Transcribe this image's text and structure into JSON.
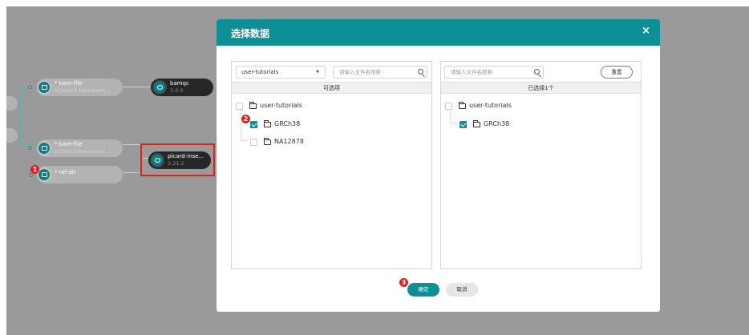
{
  "canvas": {
    "nodes": [
      {
        "title": "* bam-file",
        "subtitle": "${task-2-bwa-mem..."
      },
      {
        "title": "bamqc",
        "subtitle": "2.0.0"
      },
      {
        "title": "* bam-file",
        "subtitle": "${task-2-bwa-mem..."
      },
      {
        "title": "picard-inse...",
        "subtitle": "2.21.2"
      },
      {
        "title": "* ref-dir",
        "subtitle": ""
      }
    ],
    "step_badge_1": "1"
  },
  "dialog": {
    "title": "选择数据",
    "close_label": "×",
    "left_panel": {
      "select_value": "user-tutorials",
      "search_placeholder": "请输入文件名搜索",
      "caption": "可选项",
      "tree": [
        {
          "label": "user-tutorials",
          "checked": false
        },
        {
          "label": "GRCh38",
          "checked": true
        },
        {
          "label": "NA12878",
          "checked": false
        }
      ],
      "step_badge": "2"
    },
    "right_panel": {
      "search_placeholder": "请输入文件名搜索",
      "reset_label": "重置",
      "caption": "已选择1个",
      "tree": [
        {
          "label": "user-tutorials",
          "checked": false
        },
        {
          "label": "GRCh38",
          "checked": true
        }
      ]
    },
    "confirm_label": "确定",
    "cancel_label": "取消",
    "step_badge": "3"
  },
  "colors": {
    "accent": "#0d8f96",
    "overlay": "#9a9a9a",
    "badge": "#e0211b",
    "node_dark": "#262626"
  }
}
